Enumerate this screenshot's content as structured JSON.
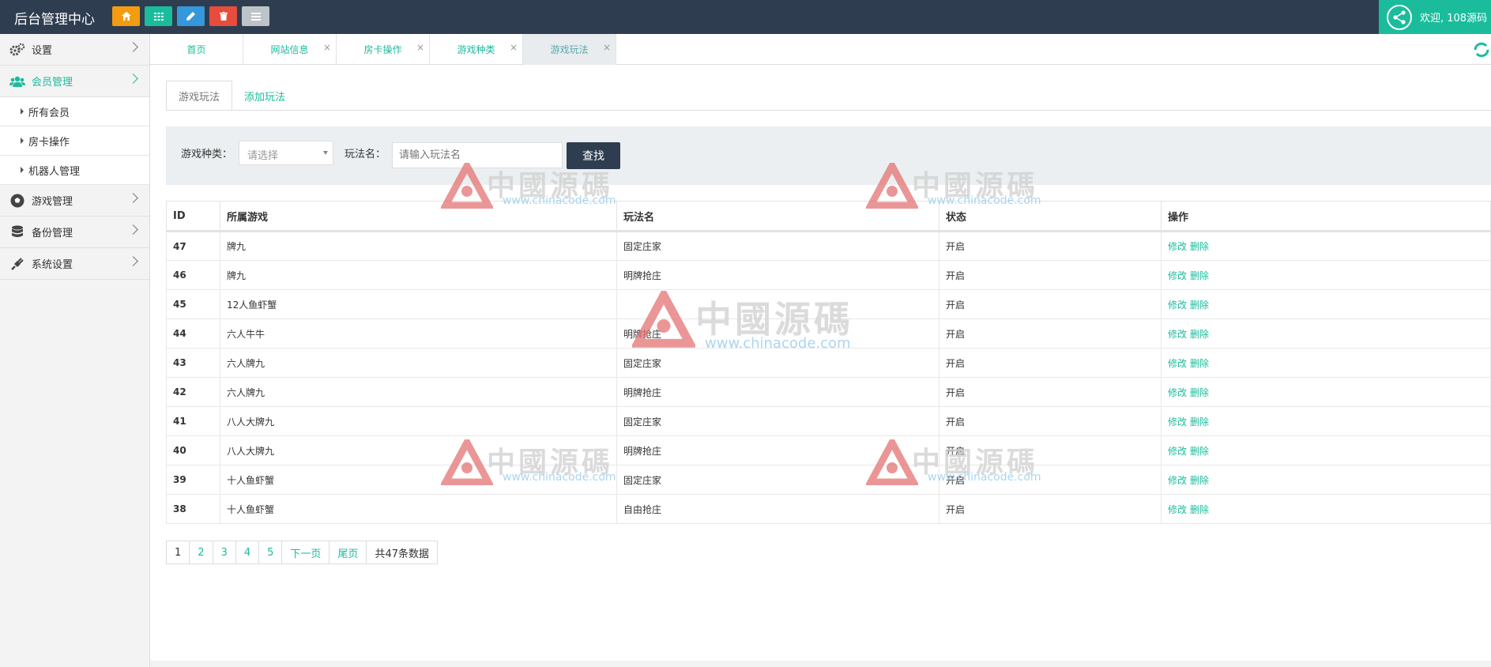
{
  "app": {
    "title": "后台管理中心"
  },
  "quick_buttons": [
    {
      "icon": "home-icon",
      "color": "#f39c12"
    },
    {
      "icon": "grid-icon",
      "color": "#1abc9c"
    },
    {
      "icon": "pencil-icon",
      "color": "#3498db"
    },
    {
      "icon": "trash-icon",
      "color": "#e74c3c"
    },
    {
      "icon": "list-icon",
      "color": "#bdc3c7"
    }
  ],
  "user": {
    "welcome": "欢迎, 108源码"
  },
  "sidebar": {
    "items": [
      {
        "label": "设置",
        "icon": "gears-icon"
      },
      {
        "label": "会员管理",
        "icon": "users-icon"
      },
      {
        "label": "游戏管理",
        "icon": "soccer-ball-icon"
      },
      {
        "label": "备份管理",
        "icon": "database-icon"
      },
      {
        "label": "系统设置",
        "icon": "plug-icon"
      }
    ],
    "subitems": [
      "所有会员",
      "房卡操作",
      "机器人管理"
    ]
  },
  "tabs": [
    {
      "label": "首页"
    },
    {
      "label": "网站信息"
    },
    {
      "label": "房卡操作"
    },
    {
      "label": "游戏种类"
    },
    {
      "label": "游戏玩法"
    }
  ],
  "content": {
    "subtabs": [
      "游戏玩法",
      "添加玩法"
    ],
    "filter": {
      "game_type_label": "游戏种类：",
      "game_type_value": "请选择",
      "play_name_label": "玩法名：",
      "play_name_placeholder": "请输入玩法名",
      "search_label": "查找"
    },
    "table": {
      "headers": [
        "ID",
        "所属游戏",
        "玩法名",
        "状态",
        "操作"
      ],
      "edit_label": "修改",
      "delete_label": "删除",
      "rows": [
        {
          "id": "47",
          "game": "牌九",
          "play": "固定庄家",
          "status": "开启"
        },
        {
          "id": "46",
          "game": "牌九",
          "play": "明牌抢庄",
          "status": "开启"
        },
        {
          "id": "45",
          "game": "12人鱼虾蟹",
          "play": "",
          "status": "开启"
        },
        {
          "id": "44",
          "game": "六人牛牛",
          "play": "明牌抢庄",
          "status": "开启"
        },
        {
          "id": "43",
          "game": "六人牌九",
          "play": "固定庄家",
          "status": "开启"
        },
        {
          "id": "42",
          "game": "六人牌九",
          "play": "明牌抢庄",
          "status": "开启"
        },
        {
          "id": "41",
          "game": "八人大牌九",
          "play": "固定庄家",
          "status": "开启"
        },
        {
          "id": "40",
          "game": "八人大牌九",
          "play": "明牌抢庄",
          "status": "开启"
        },
        {
          "id": "39",
          "game": "十人鱼虾蟹",
          "play": "固定庄家",
          "status": "开启"
        },
        {
          "id": "38",
          "game": "十人鱼虾蟹",
          "play": "自由抢庄",
          "status": "开启"
        }
      ]
    },
    "pagination": {
      "pages": [
        "1",
        "2",
        "3",
        "4",
        "5"
      ],
      "next": "下一页",
      "last": "尾页",
      "total": "共47条数据"
    }
  },
  "watermark": {
    "cn": "中國源碼",
    "url": "www.chinacode.com"
  },
  "colors": {
    "accent": "#1abc9c",
    "topbar": "#2f3d50",
    "button_dark": "#2f3d50"
  }
}
